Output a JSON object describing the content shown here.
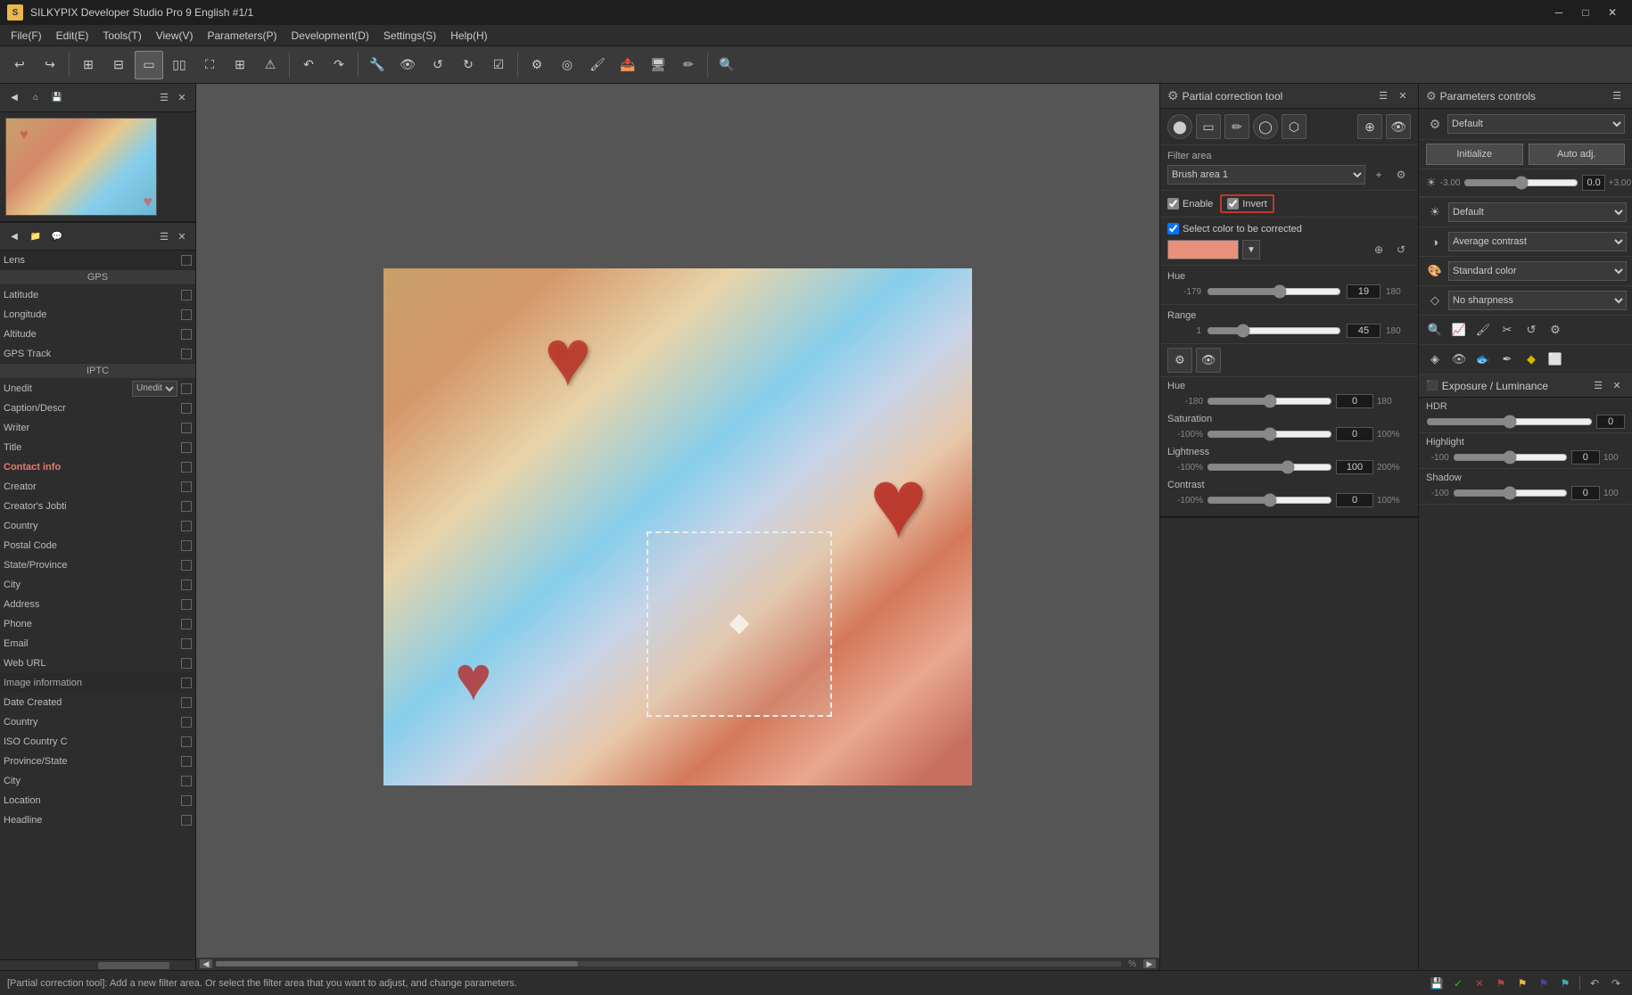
{
  "titleBar": {
    "appIcon": "S",
    "title": "SILKYPIX Developer Studio Pro 9 English  #1/1",
    "minimizeBtn": "─",
    "maximizeBtn": "□",
    "closeBtn": "✕"
  },
  "menuBar": {
    "items": [
      {
        "label": "File(F)"
      },
      {
        "label": "Edit(E)"
      },
      {
        "label": "Tools(T)"
      },
      {
        "label": "View(V)"
      },
      {
        "label": "Parameters(P)"
      },
      {
        "label": "Development(D)"
      },
      {
        "label": "Settings(S)"
      },
      {
        "label": "Help(H)"
      }
    ]
  },
  "partialToolPanel": {
    "title": "Partial correction tool",
    "filterAreaLabel": "Filter area",
    "brushAreaLabel": "Brush area 1",
    "enableLabel": "Enable",
    "invertLabel": "Invert",
    "selectColorLabel": "Select color to be corrected",
    "hueLabel": "Hue",
    "hueMin": "-179",
    "hueValue": "19",
    "hueMax": "180",
    "rangeLabel": "Range",
    "rangeMin": "1",
    "rangeValue": "45",
    "rangeMax": "180",
    "hsl": {
      "hueLabel": "Hue",
      "hueMin": "-180",
      "hueValue": "0",
      "hueMax": "180",
      "satLabel": "Saturation",
      "satMin": "-100%",
      "satValue": "0",
      "satMax": "100%",
      "lightLabel": "Lightness",
      "lightMin": "-100%",
      "lightValue": "100",
      "lightMax": "200%",
      "contrastLabel": "Contrast",
      "contrastMin": "-100%",
      "contrastValue": "0",
      "contrastMax": "100%"
    }
  },
  "paramsPanel": {
    "title": "Parameters controls",
    "presetLabel": "Default",
    "initializeBtn": "Initialize",
    "autoAdjBtn": "Auto adj.",
    "adjustValue": "0.0",
    "adjustMin": "-3.00",
    "adjustMax": "+3.00",
    "dropdowns": {
      "brightness": "Default",
      "contrast": "Average contrast",
      "color": "Standard color",
      "sharpness": "No sharpness"
    }
  },
  "exposurePanel": {
    "title": "Exposure / Luminance",
    "hdr": {
      "label": "HDR",
      "value": "0"
    },
    "highlight": {
      "label": "Highlight",
      "min": "-100",
      "value": "0",
      "max": "100"
    },
    "shadow": {
      "label": "Shadow",
      "min": "-100",
      "value": "0",
      "max": "100"
    }
  },
  "properties": {
    "sections": {
      "gps": "GPS",
      "iptc": "IPTC"
    },
    "rows": [
      {
        "label": "Lens",
        "type": "section-header"
      },
      {
        "label": "Latitude"
      },
      {
        "label": "Longitude"
      },
      {
        "label": "Altitude"
      },
      {
        "label": "GPS Track"
      },
      {
        "label": "Unedit",
        "type": "select"
      },
      {
        "label": "Caption/Descr"
      },
      {
        "label": "Writer"
      },
      {
        "label": "Title"
      },
      {
        "label": "Contact info",
        "type": "clickable"
      },
      {
        "label": "Creator"
      },
      {
        "label": "Creator's Jobti"
      },
      {
        "label": "Country"
      },
      {
        "label": "Postal Code"
      },
      {
        "label": "State/Province"
      },
      {
        "label": "City"
      },
      {
        "label": "Address"
      },
      {
        "label": "Phone"
      },
      {
        "label": "Email"
      },
      {
        "label": "Web URL"
      },
      {
        "label": "Image information",
        "type": "section-header"
      },
      {
        "label": "Date Created"
      },
      {
        "label": "Country"
      },
      {
        "label": "ISO Country C"
      },
      {
        "label": "Province/State"
      },
      {
        "label": "City"
      },
      {
        "label": "Location"
      },
      {
        "label": "Headline"
      }
    ]
  },
  "statusBar": {
    "message": "[Partial correction tool]: Add a new filter area. Or select the filter area that you want to adjust, and change parameters."
  }
}
